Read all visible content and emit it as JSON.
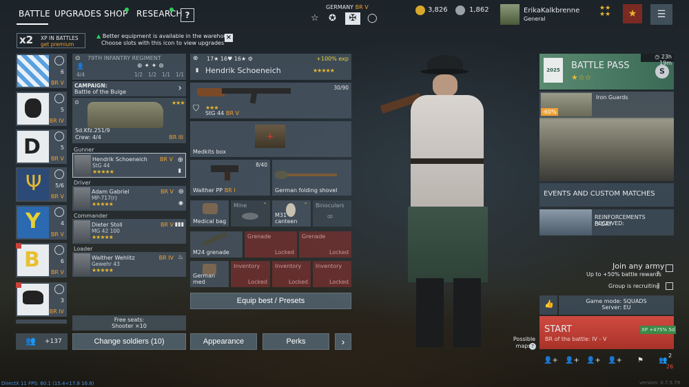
{
  "nav": {
    "battle": "BATTLE",
    "upgrades": "UPGRADES",
    "shop": "SHOP",
    "research": "RESEARCH",
    "help": "?"
  },
  "nation": {
    "name": "GERMANY",
    "br": "BR V"
  },
  "currency": {
    "gold": "3,826",
    "silver": "1,862"
  },
  "profile": {
    "name": "ErikaKalkbrenne",
    "rank": "General"
  },
  "xp_banner": {
    "mult": "x2",
    "title": "XP IN BATTLES",
    "link": "get premium"
  },
  "notice": {
    "line1": "Better equipment is available in the warehouse",
    "line2": "Choose slots with this icon to view upgrades"
  },
  "armies": [
    {
      "count": "6",
      "br": "BR V"
    },
    {
      "count": "5",
      "br": "BR IV"
    },
    {
      "count": "5",
      "br": "BR V"
    },
    {
      "count": "5/6",
      "br": "BR V"
    },
    {
      "count": "4",
      "br": "BR V"
    },
    {
      "count": "6",
      "br": "BR V"
    },
    {
      "count": "3",
      "br": "BR IV"
    }
  ],
  "army_total": "+137",
  "squad": {
    "regiment": "79TH INFANTRY REGIMENT",
    "size": "4/4",
    "ratios": [
      "1/2",
      "1/2",
      "1/1",
      "1/1"
    ],
    "campaign_label": "CAMPAIGN:",
    "campaign": "Battle of the Bulge",
    "vehicle": "Sd.Kfz.251/9",
    "crew": "Crew: 4/4",
    "vehicle_br": "BR III",
    "free_seats": "Free seats:",
    "free_seats_detail": "Shooter ×10"
  },
  "soldiers": [
    {
      "role": "Gunner",
      "name": "Hendrik Schoeneich",
      "weapon": "StG 44",
      "br": "BR V"
    },
    {
      "role": "Driver",
      "name": "Adam Gabriel",
      "weapon": "MP-717(r)",
      "br": "BR V"
    },
    {
      "role": "Commander",
      "name": "Dieter Stoll",
      "weapon": "MG 42 100",
      "br": "BR V"
    },
    {
      "role": "Loader",
      "name": "Walther Wehlitz",
      "weapon": "Gewehr 43",
      "br": "BR IV"
    }
  ],
  "soldier_header": {
    "stats": [
      "17",
      "16",
      "16"
    ],
    "exp": "+100% exp",
    "name": "Hendrik Schoeneich"
  },
  "equipment": {
    "primary": {
      "name": "StG 44",
      "br": "BR V",
      "ammo": "30/90"
    },
    "medkit": "Medkits box",
    "secondary": {
      "name": "Walther PP",
      "br": "BR I",
      "ammo": "8/40"
    },
    "shovel": "German folding shovel",
    "medbag": "Medical bag",
    "mine": "Mine",
    "canteen": "M31 canteen",
    "binoculars": "Binoculars",
    "grenade": "M24 grenade",
    "grenade_locked_1": "Grenade",
    "grenade_locked_2": "Grenade",
    "locked": "Locked",
    "german_med": "German med",
    "inventory": "Inventory"
  },
  "buttons": {
    "equip": "Equip best / Presets",
    "change_soldiers": "Change soldiers (10)",
    "appearance": "Appearance",
    "perks": "Perks",
    "next": "›"
  },
  "battle_pass": {
    "timer": "23h 19m",
    "title": "BATTLE PASS",
    "offer_name": "Iron Guards",
    "discount": "-60%",
    "events": "EVENTS AND CUSTOM MATCHES",
    "reinforcements": "REINFORCEMENTS RECEIVED:",
    "reinforcements_2": "D-DAY"
  },
  "join": {
    "title": "Join any army",
    "subtitle": "Up to +50% battle rewards",
    "recruiting": "Group is recruiting"
  },
  "mode": {
    "line1": "Game mode: SQUADS",
    "line2": "Server: EU"
  },
  "start": {
    "label": "START",
    "br": "BR of the battle: IV - V",
    "xp": "+475% 5d",
    "xp_tag": "XP",
    "maps": "Possible maps:"
  },
  "group": {
    "count_top": "2",
    "count_bottom": "26"
  },
  "footer": {
    "fps": "DirectX 11 FPS: 60.1 (15.4<17.8 16.6)",
    "version": "version: 0.7.5.79"
  },
  "colors": {
    "accent": "#f0a030",
    "gold": "#e8b830",
    "start": "#c8423a",
    "online": "#2fd05a"
  }
}
